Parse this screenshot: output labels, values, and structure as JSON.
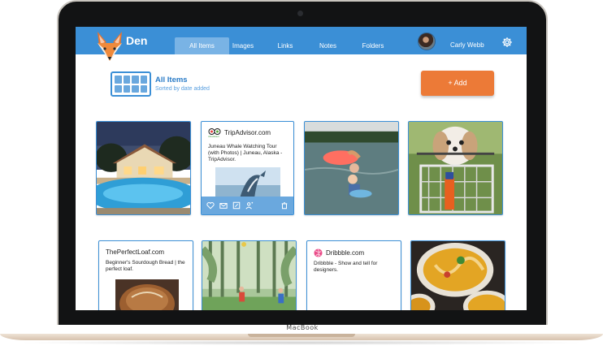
{
  "device": {
    "brand": "MacBook"
  },
  "app": {
    "name": "Den",
    "nav": {
      "tabs": [
        {
          "label": "All Items",
          "active": true
        },
        {
          "label": "Images",
          "active": false
        },
        {
          "label": "Links",
          "active": false
        },
        {
          "label": "Notes",
          "active": false
        },
        {
          "label": "Folders",
          "active": false
        }
      ]
    },
    "user": {
      "name": "Carly Webb"
    },
    "icons": {
      "settings": "gear-icon",
      "logo": "fox-logo"
    },
    "colors": {
      "header": "#3b8fd6",
      "accent": "#ec7a37",
      "active_tab": "#79b3e5"
    }
  },
  "toolbar": {
    "title": "All Items",
    "subtitle": "Sorted by date added",
    "add_label": "+ Add"
  },
  "cards": {
    "tripadvisor": {
      "site": "TripAdvisor.com",
      "logo_text": "tripadvisor",
      "description": "Juneau Whale Watching Tour (with Photos) | Juneau, Alaska - TripAdvisor.",
      "actions": [
        "heart-icon",
        "mail-icon",
        "edit-icon",
        "share-user-icon",
        "trash-icon"
      ]
    },
    "perfectloaf": {
      "site": "ThePerfectLoaf.com",
      "description": "Beginner's Sourdough Bread | the perfect loaf."
    },
    "dribbble": {
      "site": "Dribbble.com",
      "description": "Dribbble - Show and tell for designers."
    },
    "images": [
      "pool-house-photo",
      "children-lake-photo",
      "dog-bike-basket-photo",
      "children-forest-photo",
      "noodle-bowls-photo"
    ]
  }
}
